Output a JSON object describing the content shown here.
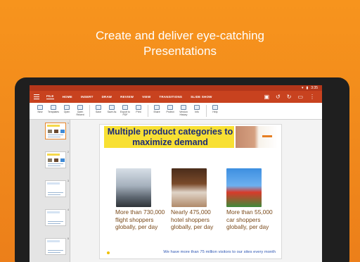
{
  "headline": {
    "line1": "Create and deliver eye-catching",
    "line2": "Presentations"
  },
  "status_bar": {
    "time": "3:35"
  },
  "menu": {
    "tabs": [
      "FILE",
      "HOME",
      "INSERT",
      "DRAW",
      "REVIEW",
      "VIEW",
      "TRANSITIONS",
      "SLIDE SHOW"
    ]
  },
  "toolbar": {
    "groups": [
      [
        "New",
        "Templates",
        "Open",
        "Open Recent"
      ],
      [
        "Save",
        "Save As",
        "Export to PDF",
        "Print"
      ],
      [
        "Share",
        "Protect",
        "Version History",
        "Info"
      ],
      [
        "Help"
      ]
    ]
  },
  "slides_panel": {
    "numbers": [
      "1",
      "2",
      "3",
      "4",
      "5"
    ]
  },
  "slide": {
    "title": "Multiple product categories to maximize demand",
    "captions": [
      "More than 730,000 flight shoppers globally, per day",
      "Nearly 475,000 hotel shoppers globally, per day",
      "More than 55,000 car shoppers globally, per day"
    ],
    "footer": "We have more than 75 million visitors to our sites every month"
  },
  "colors": {
    "background": "#f7941d",
    "menubar": "#c8421f",
    "title_band": "#f8e033",
    "title_text": "#1a2a78",
    "caption_text": "#7a4a1a",
    "footer_text": "#2f57b3"
  }
}
